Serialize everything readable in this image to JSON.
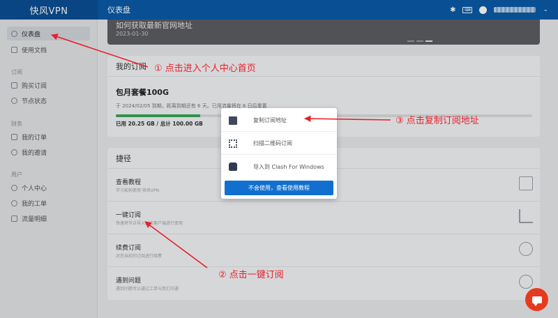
{
  "brand": "快风VPN",
  "header": {
    "page_title": "仪表盘",
    "user_chevron": "⌄"
  },
  "sidebar": {
    "items": [
      {
        "label": "仪表盘",
        "icon": "gauge-icon"
      },
      {
        "label": "使用文档",
        "icon": "book-icon"
      },
      {
        "label": "购买订阅",
        "icon": "cart-icon"
      },
      {
        "label": "节点状态",
        "icon": "check-circle-icon"
      },
      {
        "label": "我的订单",
        "icon": "order-icon"
      },
      {
        "label": "我的邀请",
        "icon": "invite-icon"
      },
      {
        "label": "个人中心",
        "icon": "user-icon"
      },
      {
        "label": "我的工单",
        "icon": "ticket-icon"
      },
      {
        "label": "流量明细",
        "icon": "traffic-icon"
      }
    ],
    "groups": [
      "订阅",
      "财务",
      "用户"
    ]
  },
  "banner": {
    "title": "如何获取最新官网地址",
    "date": "2023-01-30"
  },
  "subscription": {
    "heading": "我的订阅",
    "plan_name": "包月套餐100G",
    "description": "于 2024/02/05 到期，距离到期还有 6 天。已用流量将在 6 日后重置",
    "usage_text": "已用 20.25 GB / 总计 100.00 GB",
    "progress_percent": 20.25
  },
  "shortcuts": {
    "heading": "捷径",
    "items": [
      {
        "title": "查看教程",
        "subtitle": "学习如何使用 快风VPN",
        "icon": "book-open-icon"
      },
      {
        "title": "一键订阅",
        "subtitle": "快速将节点导入对应客户端进行使用",
        "icon": "rss-icon"
      },
      {
        "title": "续费订阅",
        "subtitle": "对您当前的订阅进行续费",
        "icon": "clock-icon"
      },
      {
        "title": "遇到问题",
        "subtitle": "遇到问题可以通过工单与我们沟通",
        "icon": "lifebuoy-icon"
      }
    ]
  },
  "popup": {
    "items": [
      {
        "label": "复制订阅地址",
        "icon": "copy-icon"
      },
      {
        "label": "扫描二维码订阅",
        "icon": "qrcode-icon"
      },
      {
        "label": "导入到 Clash For Windows",
        "icon": "clash-cat-icon"
      }
    ],
    "button": "不会使用，查看使用教程"
  },
  "annotations": {
    "note1": "① 点击进入个人中心首页",
    "note2": "② 点击一键订阅",
    "note3": "③ 点击复制订阅地址",
    "color": "#e8202a"
  },
  "colors": {
    "topbar": "#0b5ba8",
    "primary_button": "#1170cf",
    "progress": "#3aa757",
    "chat_fab": "#e63a1f"
  }
}
